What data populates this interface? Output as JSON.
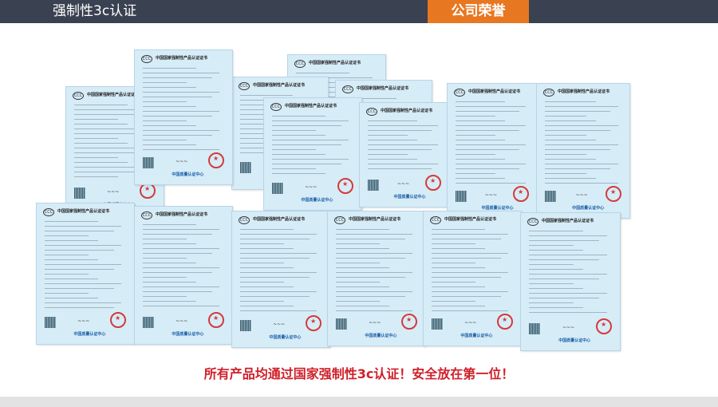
{
  "header": {
    "title": "强制性3c认证",
    "tab_label": "公司荣誉"
  },
  "certificate": {
    "title": "中国国家强制性产品认证证书",
    "logo_text": "CCC",
    "issuer": "中国质量认证中心"
  },
  "slogan": "所有产品均通过国家强制性3c认证！安全放在第一位！",
  "colors": {
    "header_bg": "#3a4150",
    "tab_bg": "#e87722",
    "slogan": "#d0202a",
    "cert_bg": "#d6ecf7",
    "seal": "#d43a3a"
  }
}
